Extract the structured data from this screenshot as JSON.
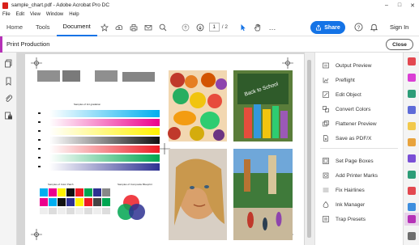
{
  "window": {
    "title": "sample_chart.pdf - Adobe Acrobat Pro DC"
  },
  "menu": [
    "File",
    "Edit",
    "View",
    "Window",
    "Help"
  ],
  "tabs": [
    "Home",
    "Tools",
    "Document"
  ],
  "page_nav": {
    "current": "1",
    "total": "/ 2"
  },
  "share_label": "Share",
  "signin_label": "Sign In",
  "production": {
    "title": "Print Production",
    "close_label": "Close"
  },
  "tools": [
    "Output Preview",
    "Preflight",
    "Edit Object",
    "Convert Colors",
    "Flattener Preview",
    "Save as PDF/X",
    "Set Page Boxes",
    "Add Printer Marks",
    "Fix Hairlines",
    "Ink Manager",
    "Trap Presets"
  ],
  "page_content": {
    "chart_caption_1": "Samples of tint gradation",
    "chart_caption_2": "Samples of Color Patch",
    "chart_caption_3": "Samples of Composite Blueprint",
    "poster_text": "Back to School"
  },
  "colors": {
    "accent": "#1473e6",
    "print_production": "#b531b7",
    "acrobat_red": "#d8201a"
  }
}
